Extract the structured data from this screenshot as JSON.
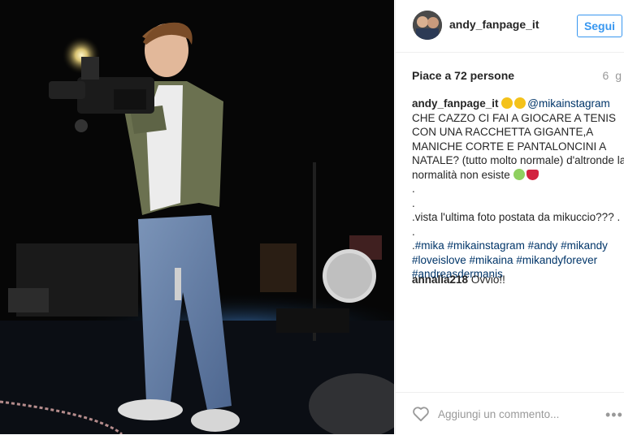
{
  "header": {
    "username": "andy_fanpage_it",
    "follow_label": "Segui"
  },
  "stats": {
    "likes": "Piace a 72 persone",
    "time": "6 g"
  },
  "caption": {
    "username": "andy_fanpage_it",
    "mention": "@mikainstagram",
    "line1": "CHE CAZZO CI FAI A GIOCARE A TENIS",
    "line2": "CON UNA RACCHETTA GIGANTE,A",
    "line3": "MANICHE CORTE E PANTALONCINI A",
    "line4": "NATALE? (tutto molto normale) d'altronde la",
    "line5": "normalità non esiste",
    "dot1": ".",
    "dot2": ".",
    "line6": ".vista l'ultima foto postata da mikuccio??? .",
    "dot3": ".",
    "tags1_prefix": ".",
    "tags1": "#mika #mikainstagram #andy #mikandy",
    "tags2": "#loveislove #mikaina #mikandyforever",
    "tags3": "#andreasdermanis"
  },
  "comments": [
    {
      "username": "annalia218",
      "text": "Ovvio!!"
    }
  ],
  "footer": {
    "add_comment_placeholder": "Aggiungi un commento...",
    "more_label": "•••"
  },
  "icons": {
    "heart": "heart-icon",
    "more": "more-options-icon",
    "emoji_eyes": "heart-eyes-emoji-icon",
    "emoji_alien": "alien-emoji-icon",
    "emoji_heart": "broken-heart-emoji-icon"
  },
  "colors": {
    "link": "#003569",
    "follow": "#3897f0",
    "muted": "#999999"
  }
}
